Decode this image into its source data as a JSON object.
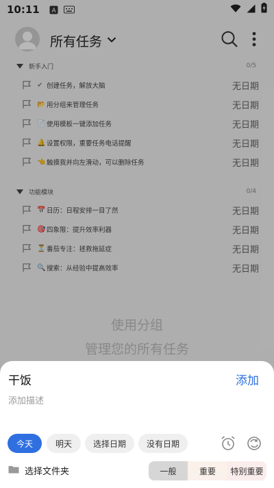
{
  "status_bar": {
    "time": "10:11",
    "icons": [
      "a-letter-icon",
      "keyboard-icon",
      "wifi-icon",
      "signal-icon",
      "battery-charging-icon"
    ]
  },
  "app_bar": {
    "title": "所有任务",
    "icons": [
      "avatar-icon",
      "chevron-down-icon",
      "search-icon",
      "more-vert-icon"
    ]
  },
  "groups": [
    {
      "name": "新手入门",
      "count": "0/5",
      "tasks": [
        {
          "emoji": "✔",
          "text": "创建任务，解放大脑",
          "date": "无日期"
        },
        {
          "emoji": "📂",
          "text": "用分组来管理任务",
          "date": "无日期"
        },
        {
          "emoji": "📄",
          "text": "使用模板一键添加任务",
          "date": "无日期"
        },
        {
          "emoji": "🔔",
          "text": "设置权限，重要任务电话提醒",
          "date": "无日期"
        },
        {
          "emoji": "👈",
          "text": "触摸我并向左滑动，可以删除任务",
          "date": "无日期"
        }
      ]
    },
    {
      "name": "功能模块",
      "count": "0/4",
      "tasks": [
        {
          "emoji": "📅",
          "text": "日历：日程安排一目了然",
          "date": "无日期"
        },
        {
          "emoji": "🎯",
          "text": "四象限：提升效率利器",
          "date": "无日期"
        },
        {
          "emoji": "⏳",
          "text": "番茄专注：拯救拖延症",
          "date": "无日期"
        },
        {
          "emoji": "🔍",
          "text": "搜索：从经验中提高效率",
          "date": "无日期"
        }
      ]
    }
  ],
  "empty_hint": {
    "line1": "使用分组",
    "line2": "管理您的所有任务"
  },
  "sheet": {
    "task_value": "干饭",
    "add_label": "添加",
    "desc_placeholder": "添加描述",
    "date_chips": [
      "今天",
      "明天",
      "选择日期",
      "没有日期"
    ],
    "active_chip": "今天",
    "icons": [
      "alarm-clock-icon",
      "repeat-icon",
      "folder-icon"
    ],
    "folder_label": "选择文件夹",
    "priorities": [
      "一般",
      "重要",
      "特别重要"
    ],
    "selected_priority": "一般"
  },
  "colors": {
    "accent": "#2f6fe0",
    "overlay": "rgba(0,0,0,0.28)"
  }
}
